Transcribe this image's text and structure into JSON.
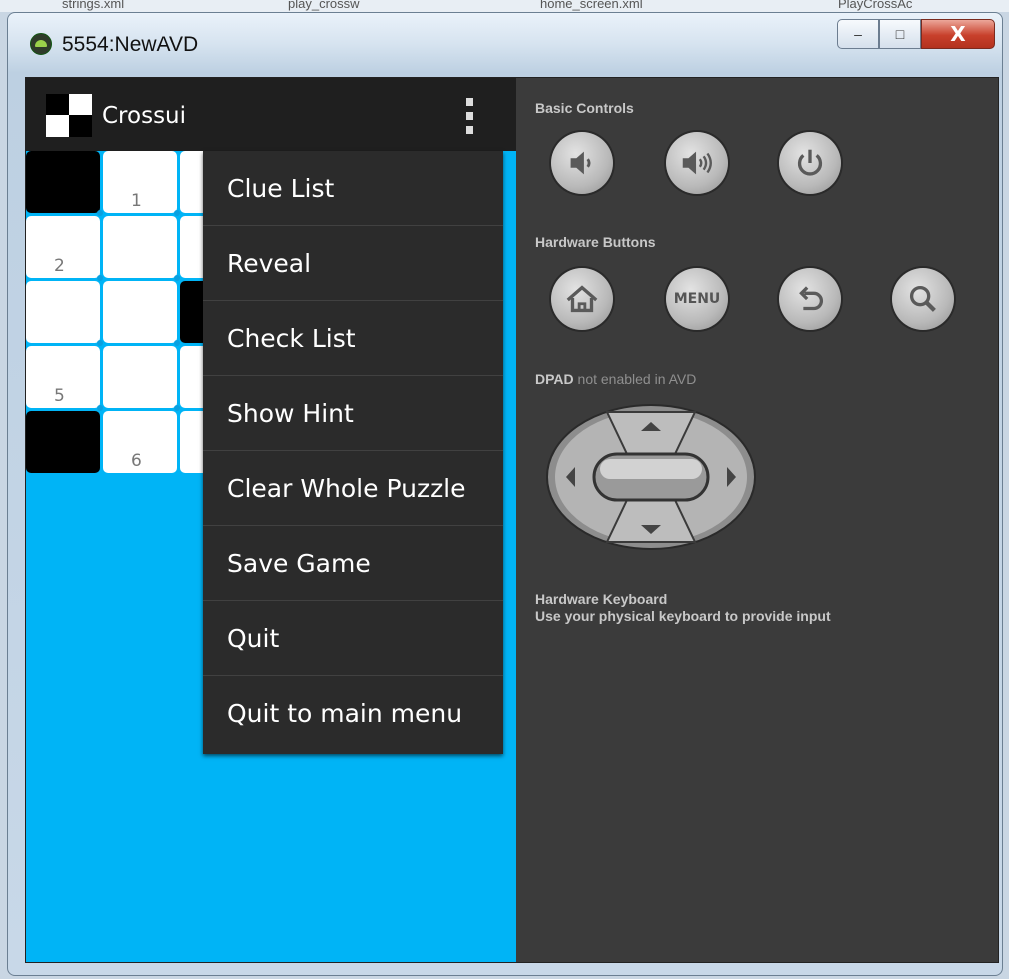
{
  "bg_tabs": [
    "strings.xml",
    "play_crossw",
    "home_screen.xml",
    "PlayCrossAc"
  ],
  "window": {
    "title": "5554:NewAVD",
    "controls": {
      "minimize": "–",
      "maximize": "□",
      "close": "X"
    }
  },
  "app": {
    "name": "Crossui"
  },
  "grid_numbers": {
    "n1": "1",
    "n2": "2",
    "n5": "5",
    "n6": "6"
  },
  "menu": {
    "items": [
      "Clue List",
      "Reveal",
      "Check List",
      "Show Hint",
      "Clear Whole Puzzle",
      "Save Game",
      "Quit",
      "Quit to main menu"
    ]
  },
  "controls_panel": {
    "basic_controls": "Basic Controls",
    "hardware_buttons": "Hardware Buttons",
    "menu_key": "MENU",
    "dpad_prefix": "DPAD",
    "dpad_suffix": " not enabled in AVD",
    "keyboard_title": "Hardware Keyboard",
    "keyboard_desc": "Use your physical keyboard to provide input"
  },
  "colors": {
    "device_bg": "#00b4f6",
    "panel_bg": "#3b3b3b",
    "menu_bg": "#2b2b2b",
    "action_bar": "#1f1f1f"
  }
}
